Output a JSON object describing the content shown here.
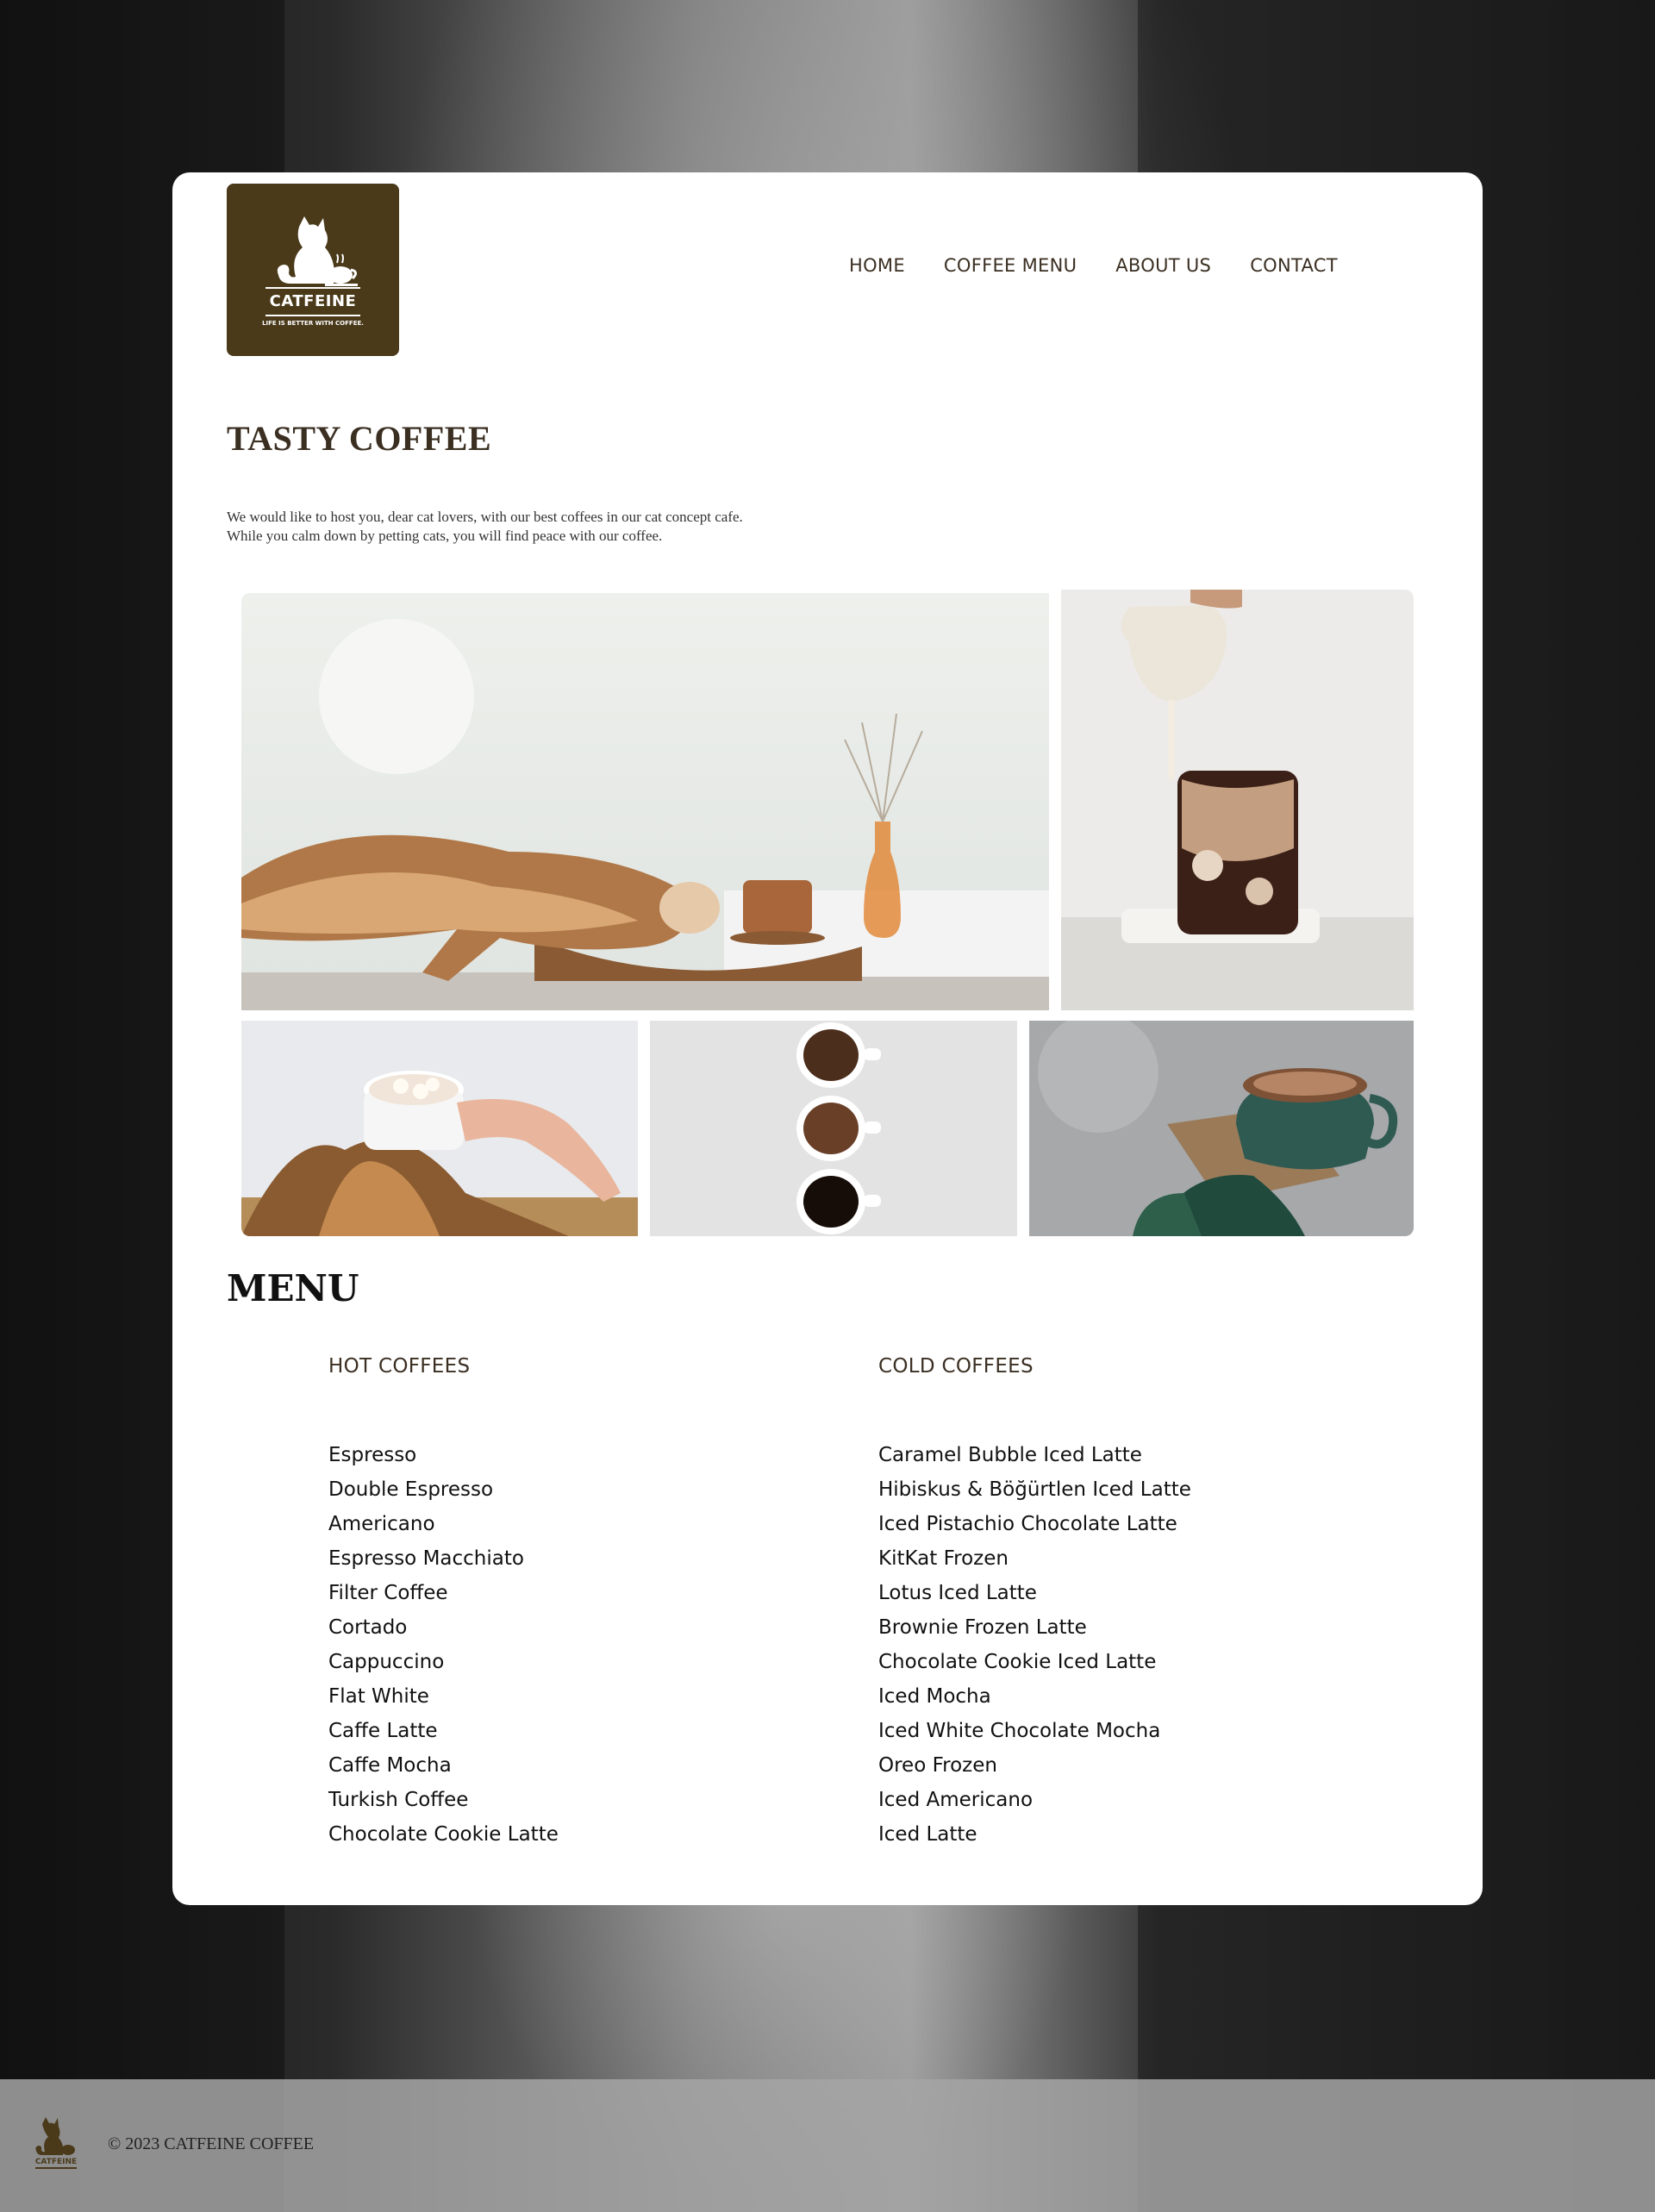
{
  "logo": {
    "name": "CATFEINE",
    "tagline": "LIFE IS BETTER WITH COFFEE."
  },
  "nav": [
    "HOME",
    "COFFEE MENU",
    "ABOUT US",
    "CONTACT"
  ],
  "hero": {
    "title": "TASTY COFFEE",
    "intro_line1": "We would like to host you, dear cat lovers, with our best coffees in our cat concept cafe.",
    "intro_line2": "While you calm down by petting cats, you will find peace with our coffee."
  },
  "gallery": [
    "photo-cat-with-coffee",
    "photo-iced-latte-pour",
    "photo-marshmallow-cocoa",
    "photo-three-coffee-cups",
    "photo-green-mug-coffee"
  ],
  "menu": {
    "title": "MENU",
    "hot": {
      "heading": "HOT COFFEES",
      "items": [
        "Espresso",
        "Double Espresso",
        "Americano",
        "Espresso Macchiato",
        "Filter Coffee",
        "Cortado",
        "Cappuccino",
        "Flat White",
        "Caffe Latte",
        "Caffe Mocha",
        "Turkish Coffee",
        "Chocolate Cookie Latte"
      ]
    },
    "cold": {
      "heading": "COLD COFFEES",
      "items": [
        "Caramel Bubble Iced Latte",
        "Hibiskus & Böğürtlen Iced Latte",
        "Iced Pistachio Chocolate Latte",
        "KitKat Frozen",
        "Lotus Iced Latte",
        "Brownie Frozen Latte",
        "Chocolate Cookie Iced Latte",
        "Iced Mocha",
        "Iced White Chocolate Mocha",
        "Oreo Frozen",
        "Iced Americano",
        "Iced Latte"
      ]
    }
  },
  "footer": {
    "copyright": "© 2023 CATFEINE COFFEE"
  },
  "colors": {
    "brand_brown": "#4a3a1a",
    "text_brown": "#3b2f22",
    "card_bg": "#ffffff",
    "footer_bg": "#a5a5a5"
  }
}
